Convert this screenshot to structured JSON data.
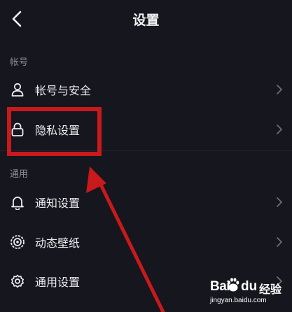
{
  "header": {
    "title": "设置",
    "back_icon": "chevron-left-icon"
  },
  "sections": {
    "account": "帐号",
    "general": "通用"
  },
  "items": {
    "account_security": {
      "label": "帐号与安全",
      "icon": "person-icon"
    },
    "privacy": {
      "label": "隐私设置",
      "icon": "lock-icon"
    },
    "notifications": {
      "label": "通知设置",
      "icon": "bell-icon"
    },
    "wallpaper": {
      "label": "动态壁纸",
      "icon": "wallpaper-icon"
    },
    "general_settings": {
      "label": "通用设置",
      "icon": "gear-icon"
    }
  },
  "annotation": {
    "highlight_color": "#c8191c",
    "arrow_color": "#c8191c"
  },
  "watermark": {
    "brand_left": "Bai",
    "brand_right": "du",
    "brand_cn": "经验",
    "url": "jingyan.baidu.com"
  },
  "colors": {
    "background": "#16161e",
    "text": "#ececef",
    "muted": "#8b8b94"
  }
}
